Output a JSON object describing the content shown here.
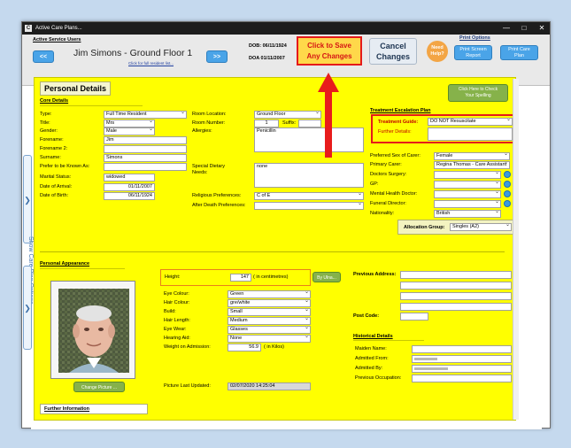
{
  "window": {
    "title": "Active Care Plans...",
    "app_icon_letter": "C",
    "controls": [
      "—",
      "□",
      "✕"
    ]
  },
  "header": {
    "active_service_users": "Active Service Users",
    "prev_label": "<<",
    "next_label": ">>",
    "resident_name": "Jim Simons - Ground Floor 1",
    "full_list_link": "Click for full resident list...",
    "dob": "DOB: 06/11/1924",
    "doa": "DOA 01/11/2007",
    "save_label_1": "Click to Save",
    "save_label_2": "Any Changes",
    "cancel_label_1": "Cancel",
    "cancel_label_2": "Changes",
    "help_label_1": "Need",
    "help_label_2": "Help?",
    "print_options": "Print Options",
    "print_screen_1": "Print Screen",
    "print_screen_2": "Report",
    "print_care_1": "Print Care",
    "print_care_2": "Plan"
  },
  "sidebar": {
    "show_options": "Show Care Plan Options",
    "arrow": "❯"
  },
  "personal": {
    "title": "Personal Details",
    "core_details": "Core Details",
    "spelling_1": "Click Here to Check",
    "spelling_2": "Your Spelling",
    "type_label": "Type:",
    "type_value": "Full Time Resident",
    "title_label": "Title:",
    "title_value": "Mrs",
    "gender_label": "Gender:",
    "gender_value": "Male",
    "forename_label": "Forename:",
    "forename_value": "Jim",
    "forename2_label": "Forename 2:",
    "forename2_value": "",
    "surname_label": "Surname:",
    "surname_value": "Simons",
    "known_as_label": "Prefer to be Known As:",
    "known_as_value": "",
    "marital_label": "Marital Status:",
    "marital_value": "widowed",
    "arrival_label": "Date of Arrival:",
    "arrival_value": "01/11/2007",
    "birth_label": "Date of Birth:",
    "birth_value": "06/11/1924",
    "room_location_label": "Room Location:",
    "room_location_value": "Ground Floor",
    "room_number_label": "Room Number:",
    "room_number_value": "1",
    "suffix_label": "Suffix:",
    "suffix_value": "",
    "allergies_label": "Allergies:",
    "allergies_value": "Penicillin",
    "dietary_label_1": "Special Dietary",
    "dietary_label_2": "Needs:",
    "dietary_value": "none",
    "religious_label": "Religious Preferences:",
    "religious_value": "C of E",
    "after_death_label": "After Death Preferences:",
    "after_death_value": ""
  },
  "escalation": {
    "title": "Treatment Escalation Plan",
    "guide_label": "Treatment Guide:",
    "guide_value": "DO NOT Resuscitate",
    "further_label": "Further Details:",
    "further_value": "",
    "sex_carer_label": "Preferred Sex of Carer:",
    "sex_carer_value": "Female",
    "primary_carer_label": "Primary Carer:",
    "primary_carer_value": "Regina Thomas - Care Assistant",
    "surgery_label": "Doctors Surgery:",
    "surgery_value": "",
    "gp_label": "GP:",
    "gp_value": "",
    "mental_label": "Mental Health Doctor:",
    "mental_value": "",
    "funeral_label": "Funeral Director:",
    "funeral_value": "",
    "nationality_label": "Nationality:",
    "nationality_value": "British",
    "allocation_label": "Allocation Group:",
    "allocation_value": "Singles (A2)"
  },
  "appearance": {
    "title": "Personal Appearance",
    "height_label": "Height:",
    "height_value": "147",
    "height_unit": "( in centimetres)",
    "by_ulna": "By Ulna...",
    "eye_label": "Eye Colour:",
    "eye_value": "Green",
    "hair_label": "Hair Colour:",
    "hair_value": "gre/white",
    "build_label": "Build:",
    "build_value": "Small",
    "hair_length_label": "Hair Length:",
    "hair_length_value": "Medium",
    "eyewear_label": "Eye Wear:",
    "eyewear_value": "Glasses",
    "hearing_label": "Hearing Aid:",
    "hearing_value": "None",
    "weight_label": "Weight on Admission:",
    "weight_value": "56.9",
    "weight_unit": "( in Kilos)",
    "change_picture": "Change Picture ...",
    "picture_updated_label": "Picture Last Updated:",
    "picture_updated_value": "02/07/2020 14:25:04"
  },
  "address": {
    "previous_label": "Previous Address:",
    "postcode_label": "Post Code:",
    "historical_title": "Historical Details",
    "maiden_label": "Maiden Name:",
    "admitted_from_label": "Admitted From:",
    "admitted_by_label": "Admitted By:",
    "occupation_label": "Previous Occupation:"
  },
  "further": {
    "title": "Further Information"
  },
  "colors": {
    "accent_red": "#e51a1a",
    "panel_yellow": "#ffff00",
    "nav_blue": "#4aa4e8",
    "help_orange": "#f3a545"
  }
}
